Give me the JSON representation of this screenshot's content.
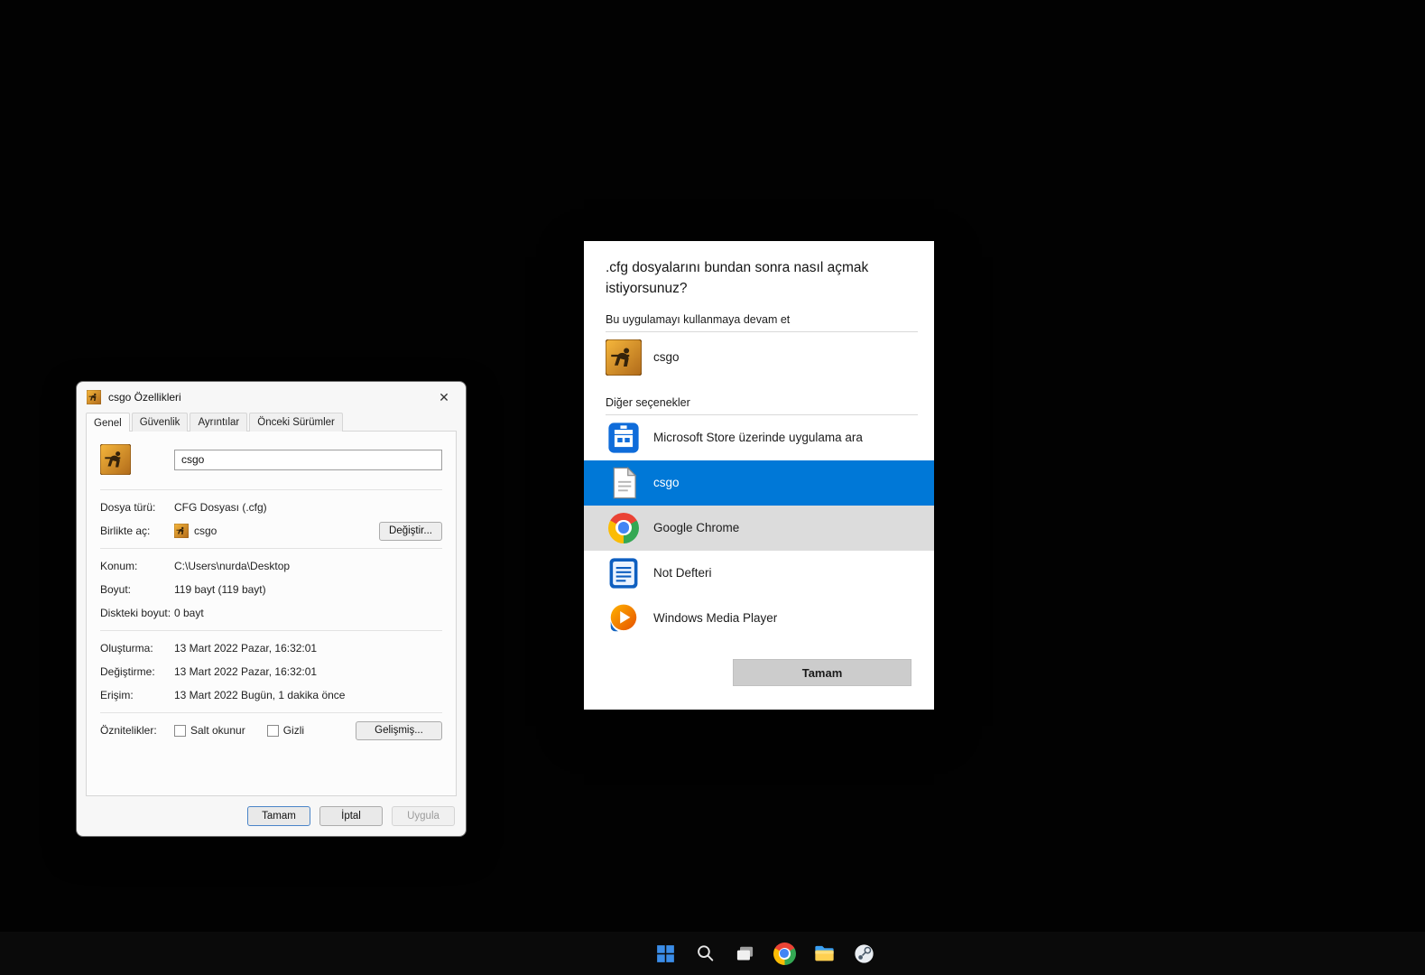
{
  "colors": {
    "selection_blue": "#0078d7",
    "hover_gray": "#dcdcdc",
    "desktop_bg": "#020202",
    "csgo_orange": "#e8962e"
  },
  "properties_dialog": {
    "title": "csgo Özellikleri",
    "close_glyph": "✕",
    "tabs": [
      "Genel",
      "Güvenlik",
      "Ayrıntılar",
      "Önceki Sürümler"
    ],
    "filename_value": "csgo",
    "fields": {
      "file_type": {
        "label": "Dosya türü:",
        "value": "CFG Dosyası (.cfg)"
      },
      "opens_with": {
        "label": "Birlikte aç:",
        "value": "csgo",
        "button": "Değiştir..."
      },
      "location": {
        "label": "Konum:",
        "value": "C:\\Users\\nurda\\Desktop"
      },
      "size": {
        "label": "Boyut:",
        "value": "119 bayt (119 bayt)"
      },
      "size_on_disk": {
        "label": "Diskteki boyut:",
        "value": "0 bayt"
      },
      "created": {
        "label": "Oluşturma:",
        "value": "13 Mart 2022 Pazar, 16:32:01"
      },
      "modified": {
        "label": "Değiştirme:",
        "value": "13 Mart 2022 Pazar, 16:32:01"
      },
      "accessed": {
        "label": "Erişim:",
        "value": "13 Mart 2022 Bugün, 1 dakika önce"
      },
      "attributes": {
        "label": "Öznitelikler:",
        "readonly": "Salt okunur",
        "readonly_checked": false,
        "hidden": "Gizli",
        "hidden_checked": false,
        "button": "Gelişmiş..."
      }
    },
    "buttons": {
      "ok": "Tamam",
      "cancel": "İptal",
      "apply": "Uygula"
    }
  },
  "open_with_dialog": {
    "title": ".cfg dosyalarını bundan sonra nasıl açmak istiyorsunuz?",
    "keep_section_label": "Bu uygulamayı kullanmaya devam et",
    "current_app": {
      "name": "csgo",
      "icon": "csgo-icon"
    },
    "other_section_label": "Diğer seçenekler",
    "options": [
      {
        "name": "Microsoft Store üzerinde uygulama ara",
        "icon": "microsoft-store-icon",
        "state": "normal"
      },
      {
        "name": "csgo",
        "icon": "document-icon",
        "state": "selected"
      },
      {
        "name": "Google Chrome",
        "icon": "chrome-icon",
        "state": "hover"
      },
      {
        "name": "Not Defteri",
        "icon": "notepad-icon",
        "state": "normal"
      },
      {
        "name": "Windows Media Player",
        "icon": "media-player-icon",
        "state": "normal"
      }
    ],
    "ok_button": "Tamam"
  },
  "taskbar": {
    "icons": [
      "start",
      "search",
      "task-view",
      "chrome",
      "file-explorer",
      "steam"
    ]
  }
}
